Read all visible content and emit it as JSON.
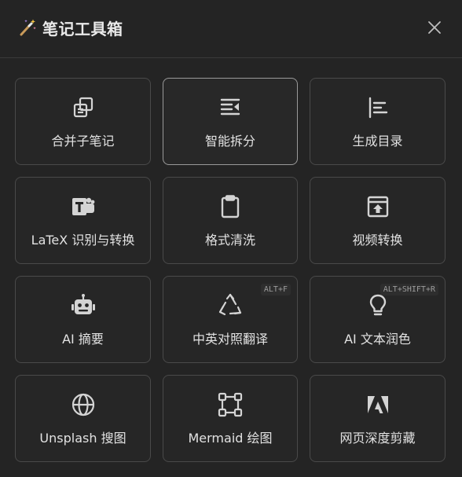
{
  "dialog": {
    "title": "笔记工具箱",
    "title_icon": "magic-wand-icon",
    "close_icon": "close-icon"
  },
  "tools": [
    {
      "label": "合并子笔记",
      "icon": "merge-notes-icon",
      "shortcut": ""
    },
    {
      "label": "智能拆分",
      "icon": "smart-split-icon",
      "shortcut": ""
    },
    {
      "label": "生成目录",
      "icon": "toc-icon",
      "shortcut": ""
    },
    {
      "label": "LaTeX 识别与转换",
      "icon": "teams-icon",
      "shortcut": ""
    },
    {
      "label": "格式清洗",
      "icon": "clipboard-icon",
      "shortcut": ""
    },
    {
      "label": "视频转换",
      "icon": "upload-box-icon",
      "shortcut": ""
    },
    {
      "label": "AI 摘要",
      "icon": "robot-icon",
      "shortcut": ""
    },
    {
      "label": "中英对照翻译",
      "icon": "recycle-icon",
      "shortcut": "ALT+F"
    },
    {
      "label": "AI 文本润色",
      "icon": "lightbulb-icon",
      "shortcut": "ALT+SHIFT+R"
    },
    {
      "label": "Unsplash 搜图",
      "icon": "globe-icon",
      "shortcut": ""
    },
    {
      "label": "Mermaid 绘图",
      "icon": "vector-square-icon",
      "shortcut": ""
    },
    {
      "label": "网页深度剪藏",
      "icon": "adobe-icon",
      "shortcut": ""
    }
  ],
  "colors": {
    "background": "#242424",
    "card_border": "#4a4a4a",
    "active_border": "#9a9a9a",
    "icon": "#d4d4d4",
    "text": "#e2e2e2"
  }
}
